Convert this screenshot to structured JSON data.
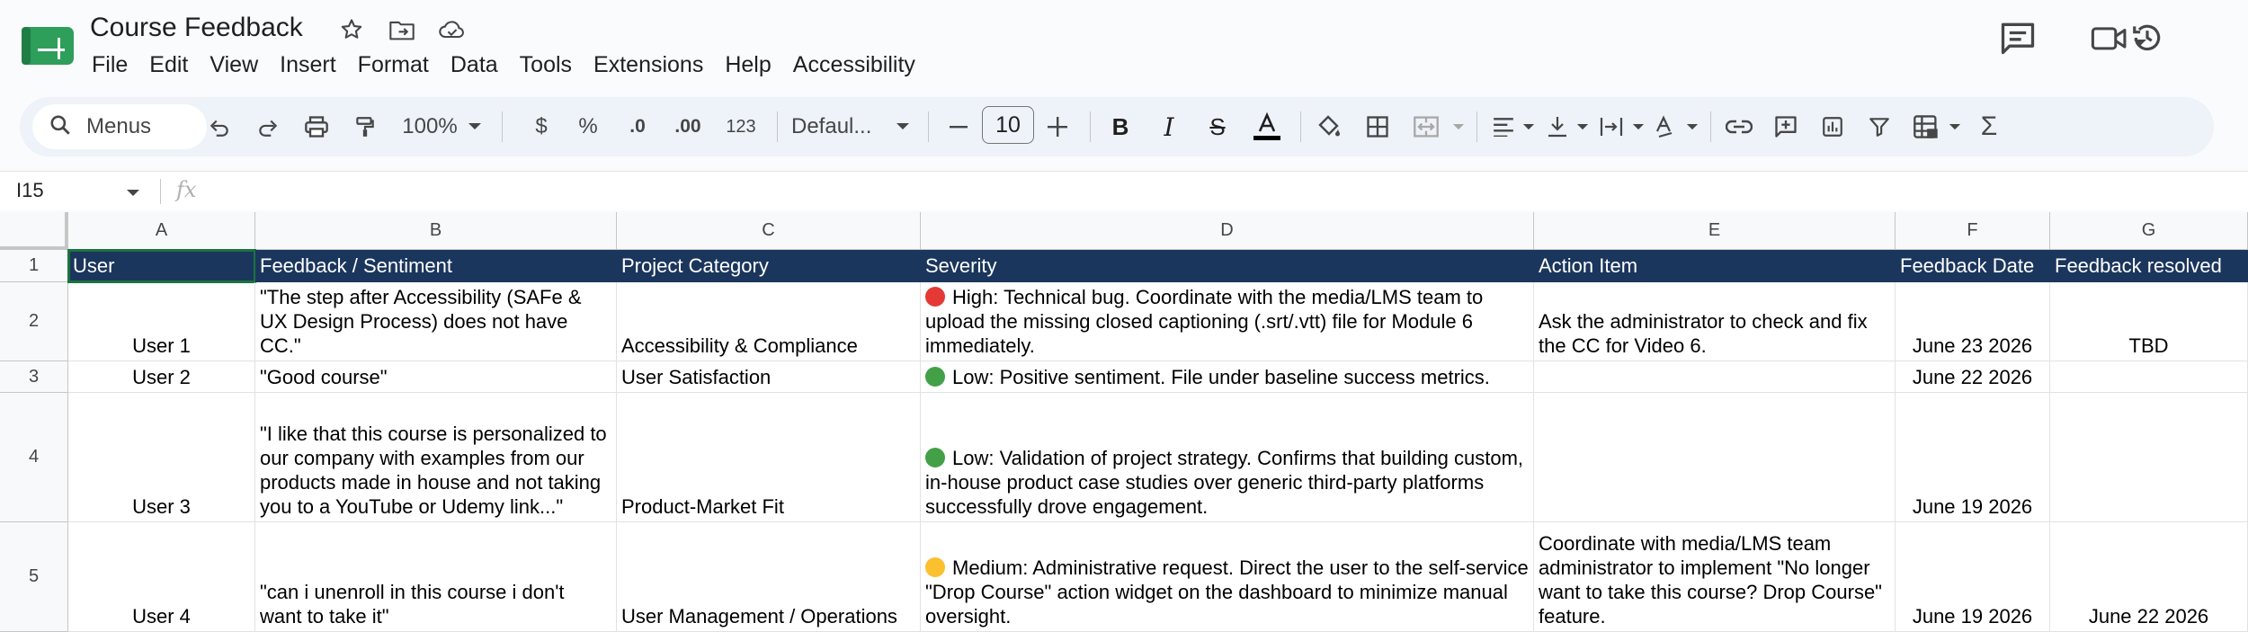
{
  "app": {
    "title": "Course Feedback",
    "menus": [
      "File",
      "Edit",
      "View",
      "Insert",
      "Format",
      "Data",
      "Tools",
      "Extensions",
      "Help",
      "Accessibility"
    ]
  },
  "toolbar": {
    "search_label": "Menus",
    "zoom": "100%",
    "currency": "$",
    "percent": "%",
    "decrease_decimal": ".0",
    "increase_decimal": ".00",
    "number_format": "123",
    "font": "Defaul...",
    "font_size": "10"
  },
  "formula_bar": {
    "cell_ref": "I15",
    "fx": "fx",
    "value": ""
  },
  "columns": [
    "A",
    "B",
    "C",
    "D",
    "E",
    "F",
    "G"
  ],
  "rows": [
    "1",
    "2",
    "3",
    "4",
    "5"
  ],
  "sheet": {
    "header": [
      "User",
      "Feedback / Sentiment",
      "Project Category",
      "Severity",
      "Action Item",
      "Feedback Date",
      "Feedback resolved"
    ],
    "data": [
      [
        "User 1",
        "\"The step after Accessibility (SAFe & UX Design Process) does not have CC.\"",
        "Accessibility & Compliance",
        "High: Technical bug. Coordinate with the media/LMS team to upload the missing closed captioning (.srt/.vtt) file for Module 6 immediately.",
        "Ask the administrator to check and fix the CC for Video 6.",
        "June 23 2026",
        "TBD"
      ],
      [
        "User 2",
        "\"Good course\"",
        "User Satisfaction",
        "Low: Positive sentiment. File under baseline success metrics.",
        "",
        "June 22 2026",
        ""
      ],
      [
        "User 3",
        "\"I like that this course is personalized to our company with examples from our products made in house and not taking you to a YouTube or Udemy link...\"",
        "Product-Market Fit",
        "Low: Validation of project strategy. Confirms that building custom, in-house product case studies over generic third-party platforms successfully drove engagement.",
        "",
        "June 19 2026",
        ""
      ],
      [
        "User 4",
        "\"can i unenroll in this course i don't want to take it\"",
        "User Management / Operations",
        "Medium: Administrative request. Direct the user to the self-service \"Drop Course\" action widget on the dashboard to minimize manual oversight.",
        "Coordinate with media/LMS team administrator to implement \"No longer want to take this course? Drop Course\" feature.",
        "June 19 2026",
        "June 22 2026"
      ]
    ],
    "severity_colors": [
      "#e53935",
      "#43a047",
      "#43a047",
      "#fbc02d"
    ]
  },
  "colors": {
    "header_bg": "#1b365d",
    "header_text": "#ffffff",
    "selection": "#1a7340",
    "toolbar_bg": "#eef2f9"
  }
}
